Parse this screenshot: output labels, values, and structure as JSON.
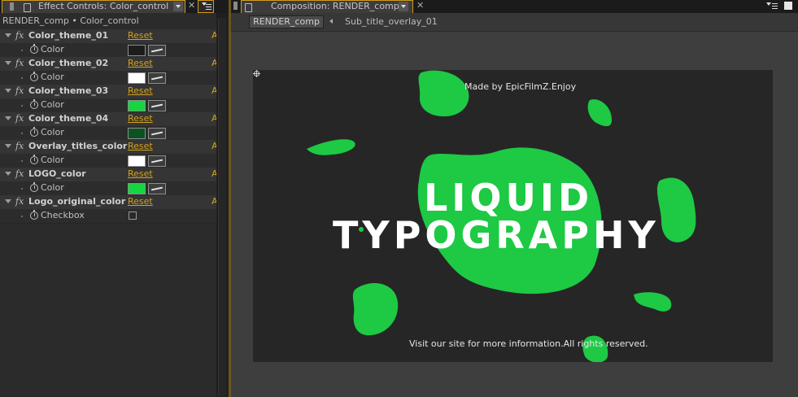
{
  "left_panel": {
    "tab_title": "Effect Controls: Color_control",
    "breadcrumb": "RENDER_comp • Color_control",
    "reset_label": "Reset",
    "edge_letter": "A",
    "effects": [
      {
        "name": "Color_theme_01",
        "prop": "Color",
        "kind": "color",
        "swatch": "#1d1d1d"
      },
      {
        "name": "Color_theme_02",
        "prop": "Color",
        "kind": "color",
        "swatch": "#ffffff"
      },
      {
        "name": "Color_theme_03",
        "prop": "Color",
        "kind": "color",
        "swatch": "#16d640"
      },
      {
        "name": "Color_theme_04",
        "prop": "Color",
        "kind": "color",
        "swatch": "#0d5222"
      },
      {
        "name": "Overlay_titles_color",
        "prop": "Color",
        "kind": "color",
        "swatch": "#ffffff"
      },
      {
        "name": "LOGO_color",
        "prop": "Color",
        "kind": "color",
        "swatch": "#16d640"
      },
      {
        "name": "Logo_original_color",
        "prop": "Checkbox",
        "kind": "checkbox",
        "swatch": ""
      }
    ]
  },
  "right_panel": {
    "tab_title": "Composition: RENDER_comp",
    "render_button": "RENDER_comp",
    "sub_comp": "Sub_title_overlay_01"
  },
  "composition": {
    "made_by": "Made by EpicFilmZ.Enjoy",
    "title_line_1": "LIQUID",
    "title_line_2": "TYPOGRAPHY",
    "footer": "Visit our site for more information.All rights reserved.",
    "blob_color": "#1ec944",
    "bg_color": "#262626"
  },
  "colors": {
    "accent": "#d5a21f"
  }
}
